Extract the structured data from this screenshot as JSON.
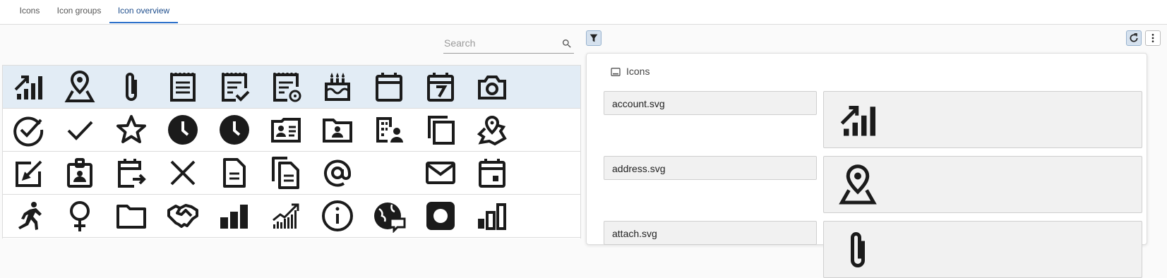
{
  "tabs": [
    {
      "label": "Icons",
      "active": false
    },
    {
      "label": "Icon groups",
      "active": false
    },
    {
      "label": "Icon overview",
      "active": true
    }
  ],
  "search": {
    "placeholder": "Search",
    "value": ""
  },
  "grid": {
    "rows": [
      [
        "chart-up-icon",
        "location-pin-icon",
        "paperclip-icon",
        "notepad-icon",
        "notepad-check-icon",
        "notepad-gear-icon",
        "birthday-cake-icon",
        "calendar-icon",
        "calendar-7-icon",
        "camera-icon"
      ],
      [
        "circle-check-icon",
        "check-icon",
        "star-icon",
        "clock-filled-icon",
        "clock-filled-icon",
        "contact-card-icon",
        "folder-person-icon",
        "building-person-icon",
        "copy-icon",
        "map-pin-icon"
      ],
      [
        "edit-icon",
        "badge-icon",
        "calendar-export-icon",
        "close-icon",
        "document-icon",
        "documents-icon",
        "at-sign-icon",
        "",
        "envelope-icon",
        "calendar-event-icon"
      ],
      [
        "running-person-icon",
        "female-icon",
        "folder-icon",
        "handshake-icon",
        "bar-chart-icon",
        "trend-chart-icon",
        "info-icon",
        "globe-chat-icon",
        "record-icon",
        "bar-chart-outline-icon"
      ]
    ],
    "selected_row": 0
  },
  "panel": {
    "title": "Icons",
    "items": [
      {
        "file": "account.svg",
        "icon": "chart-up-icon"
      },
      {
        "file": "address.svg",
        "icon": "location-pin-icon"
      },
      {
        "file": "attach.svg",
        "icon": "paperclip-icon"
      }
    ]
  },
  "toolbar": {
    "filter_icon": "filter-icon",
    "refresh_icon": "refresh-icon",
    "more_icon": "more-vertical-icon"
  },
  "colors": {
    "accent": "#2a6fc9",
    "selected_row": "#e2ecf5",
    "icon": "#1b1b1b"
  }
}
